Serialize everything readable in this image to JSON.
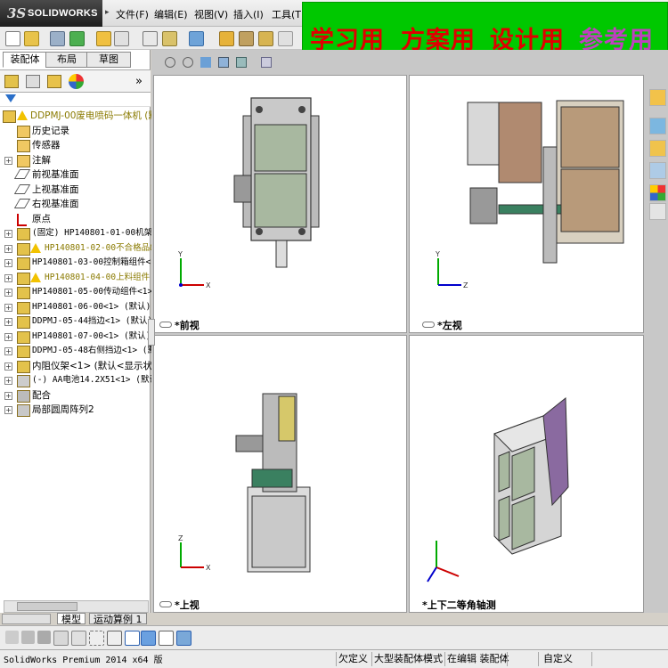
{
  "app": {
    "logo_prefix": "3S",
    "logo_name": "SOLIDWORKS"
  },
  "menu": [
    "文件(F)",
    "编辑(E)",
    "视图(V)",
    "插入(I)",
    "工具(T)"
  ],
  "banner": {
    "words": [
      "学习用",
      "方案用",
      "设计用",
      "参考用"
    ],
    "bg_color": "#00c800",
    "text_color": "#e00000",
    "last_word_color": "#c040c0"
  },
  "panel_tabs": [
    "装配体",
    "布局",
    "草图"
  ],
  "filter_icon": "filter-icon",
  "expand_glyph": "»",
  "tree": [
    {
      "label": "DDPMJ-00废电喷码一体机  (默",
      "icon": "assembly-warning-icon",
      "exp": "",
      "warn": true,
      "root": true
    },
    {
      "label": "历史记录",
      "icon": "history-icon",
      "exp": ""
    },
    {
      "label": "传感器",
      "icon": "sensor-icon",
      "exp": ""
    },
    {
      "label": "注解",
      "icon": "annotation-icon",
      "exp": "+"
    },
    {
      "label": "前视基准面",
      "icon": "plane-icon",
      "exp": ""
    },
    {
      "label": "上视基准面",
      "icon": "plane-icon",
      "exp": ""
    },
    {
      "label": "右视基准面",
      "icon": "plane-icon",
      "exp": ""
    },
    {
      "label": "原点",
      "icon": "origin-icon",
      "exp": ""
    },
    {
      "label": "(固定) HP140801-01-00机架&",
      "icon": "subassembly-icon",
      "exp": "+"
    },
    {
      "label": "HP140801-02-00不合格品&",
      "icon": "subassembly-warning-icon",
      "exp": "+",
      "warn": true
    },
    {
      "label": "HP140801-03-00控制箱组件<1",
      "icon": "subassembly-icon",
      "exp": "+"
    },
    {
      "label": "HP140801-04-00上料组件",
      "icon": "subassembly-warning-icon",
      "exp": "+",
      "warn": true
    },
    {
      "label": "HP140801-05-00传动组件<1>",
      "icon": "subassembly-icon",
      "exp": "+"
    },
    {
      "label": "HP140801-06-00<1> (默认)",
      "icon": "subassembly-icon",
      "exp": "+"
    },
    {
      "label": "DDPMJ-05-44挡边<1> (默认)",
      "icon": "subassembly-icon",
      "exp": "+"
    },
    {
      "label": "HP140801-07-00<1> (默认) 默",
      "icon": "subassembly-icon",
      "exp": "+"
    },
    {
      "label": "DDPMJ-05-48右侧挡边<1> (默",
      "icon": "subassembly-icon",
      "exp": "+"
    },
    {
      "label": "内阻仪架<1> (默认<显示状态",
      "icon": "subassembly-icon",
      "exp": "+"
    },
    {
      "label": "(-) AA电池14.2X51<1> (默认",
      "icon": "part-icon",
      "exp": "+"
    },
    {
      "label": "配合",
      "icon": "mates-icon",
      "exp": "+"
    },
    {
      "label": "局部圆周阵列2",
      "icon": "pattern-icon",
      "exp": "+"
    }
  ],
  "viewports": {
    "front": "*前视",
    "left": "*左视",
    "top": "*上视",
    "iso": "*上下二等角轴测"
  },
  "triad": {
    "x": "X",
    "y": "Y",
    "z": "Z"
  },
  "model_tabs": [
    "模型",
    "运动算例 1"
  ],
  "status": {
    "app": "SolidWorks Premium 2014 x64 版",
    "constraint": "欠定义",
    "mode": "大型装配体模式",
    "editing": "在编辑 装配体",
    "custom": "自定义"
  }
}
